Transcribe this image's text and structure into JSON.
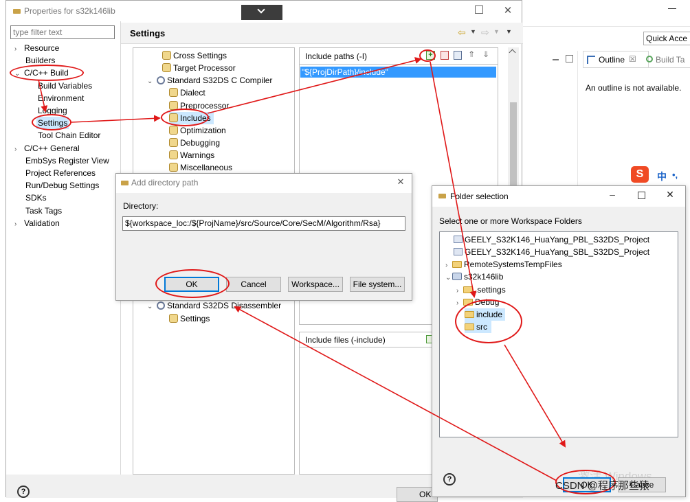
{
  "properties": {
    "title": "Properties for s32k146lib",
    "filter_placeholder": "type filter text",
    "nav": [
      "Resource",
      "Builders",
      "C/C++ Build",
      "Build Variables",
      "Environment",
      "Logging",
      "Settings",
      "Tool Chain Editor",
      "C/C++ General",
      "EmbSys Register View",
      "Project References",
      "Run/Debug Settings",
      "SDKs",
      "Task Tags",
      "Validation"
    ],
    "heading": "Settings",
    "settings_tree": [
      "Cross Settings",
      "Target Processor",
      "Standard S32DS C Compiler",
      "Dialect",
      "Preprocessor",
      "Includes",
      "Optimization",
      "Debugging",
      "Warnings",
      "Miscellaneous",
      "Standard S32DS Disassembler",
      "Settings"
    ],
    "include_paths_label": "Include paths (-I)",
    "include_paths": [
      "\"${ProjDirPath}/include\""
    ],
    "include_files_label": "Include files (-include)",
    "help": "?",
    "partial_button": "OK"
  },
  "ide": {
    "quick_access": "Quick Acce",
    "outline_tab": "Outline",
    "outline_close": "☒",
    "build_tab": "Build Ta",
    "outline_message": "An outline is not available."
  },
  "ime": {
    "lang": "中",
    "punct": "•,"
  },
  "add_dir": {
    "title": "Add directory path",
    "label": "Directory:",
    "path": "${workspace_loc:/${ProjName}/src/Source/Core/SecM/Algorithm/Rsa}",
    "ok": "OK",
    "cancel": "Cancel",
    "workspace": "Workspace...",
    "filesystem": "File system..."
  },
  "folder_sel": {
    "title": "Folder selection",
    "instruction": "Select one or more Workspace Folders",
    "items": [
      "GEELY_S32K146_HuaYang_PBL_S32DS_Project",
      "GEELY_S32K146_HuaYang_SBL_S32DS_Project",
      "RemoteSystemsTempFiles",
      "s32k146lib",
      ".settings",
      "Debug",
      "include",
      "src"
    ],
    "watermark": "激活 Windows",
    "help": "?",
    "ok": "OK",
    "cancel": "Cance"
  },
  "credit": "CSDN @程序那些猿"
}
